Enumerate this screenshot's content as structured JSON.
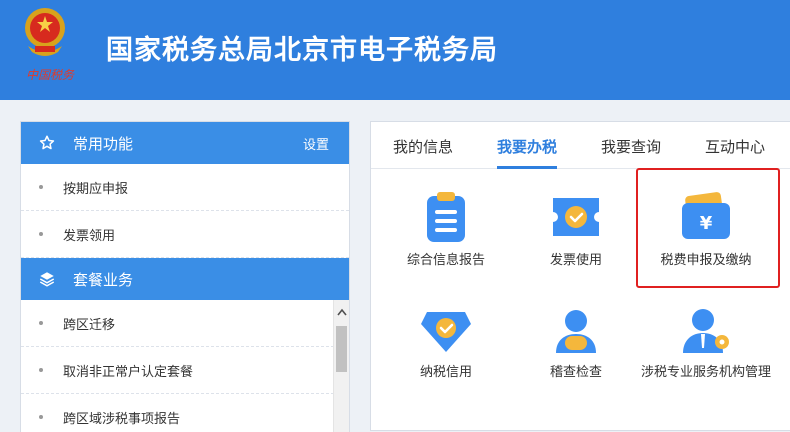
{
  "header": {
    "title": "国家税务总局北京市电子税务局",
    "emblem_caption": "中国税务",
    "background": "#2f7fde"
  },
  "left": {
    "favorites": {
      "title": "常用功能",
      "action": "设置",
      "icon": "star-icon",
      "items": [
        "按期应申报",
        "发票领用"
      ]
    },
    "packages": {
      "title": "套餐业务",
      "icon": "layers-icon",
      "items": [
        "跨区迁移",
        "取消非正常户认定套餐",
        "跨区域涉税事项报告"
      ]
    }
  },
  "tabs": [
    "我的信息",
    "我要办税",
    "我要查询",
    "互动中心"
  ],
  "active_tab": "我要办税",
  "tiles": [
    {
      "label": "综合信息报告",
      "icon": "clipboard-icon"
    },
    {
      "label": "发票使用",
      "icon": "invoice-ticket-icon"
    },
    {
      "label": "税费申报及缴纳",
      "icon": "yen-wallet-icon"
    },
    {
      "label": "纳税信用",
      "icon": "credit-gem-icon"
    },
    {
      "label": "稽查检查",
      "icon": "inspector-person-icon"
    },
    {
      "label": "涉税专业服务机构管理",
      "icon": "agent-person-icon"
    }
  ],
  "colors": {
    "accent": "#2f7fde",
    "highlight": "#e02020"
  }
}
